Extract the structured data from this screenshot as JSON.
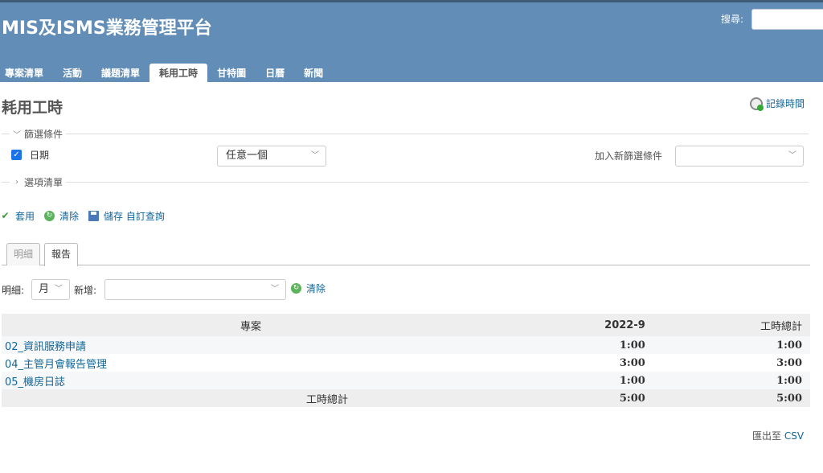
{
  "app": {
    "title": "MIS及ISMS業務管理平台"
  },
  "search": {
    "label": "搜尋:",
    "value": ""
  },
  "menu": [
    {
      "label": "專案清單",
      "active": false
    },
    {
      "label": "活動",
      "active": false
    },
    {
      "label": "議題清單",
      "active": false
    },
    {
      "label": "耗用工時",
      "active": true
    },
    {
      "label": "甘特圖",
      "active": false
    },
    {
      "label": "日曆",
      "active": false
    },
    {
      "label": "新聞",
      "active": false
    }
  ],
  "page": {
    "title": "耗用工時",
    "log_time_label": "記錄時間"
  },
  "filters": {
    "legend": "篩選條件",
    "date_label": "日期",
    "date_checked": true,
    "date_operator": "任意一個",
    "add_filter_label": "加入新篩選條件",
    "add_filter_value": ""
  },
  "options": {
    "legend": "選項清單"
  },
  "actions": {
    "apply": "套用",
    "clear": "清除",
    "save": "儲存 自訂查詢"
  },
  "tabs": [
    {
      "label": "明細",
      "selected": false
    },
    {
      "label": "報告",
      "selected": true
    }
  ],
  "report": {
    "detail_label": "明細:",
    "period_value": "月",
    "add_label": "新增:",
    "add_value": "",
    "clear_label": "清除",
    "columns": [
      "專案",
      "2022-9",
      "工時總計"
    ],
    "rows": [
      {
        "project": "02_資訊服務申請",
        "period": "1:00",
        "total": "1:00"
      },
      {
        "project": "04_主管月會報告管理",
        "period": "3:00",
        "total": "3:00"
      },
      {
        "project": "05_機房日誌",
        "period": "1:00",
        "total": "1:00"
      }
    ],
    "total_row": {
      "label": "工時總計",
      "period": "5:00",
      "total": "5:00"
    }
  },
  "export": {
    "label": "匯出至",
    "link": "CSV"
  },
  "colors": {
    "header": "#628db6",
    "link": "#169"
  }
}
